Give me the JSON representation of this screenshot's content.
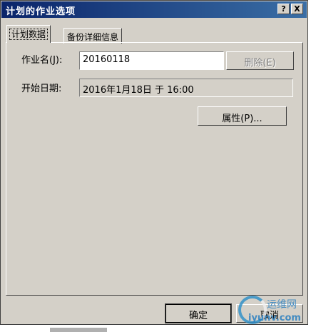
{
  "window": {
    "title": "计划的作业选项",
    "help_label": "?",
    "close_label": "X"
  },
  "tabs": [
    {
      "label": "计划数据",
      "active": true
    },
    {
      "label": "备份详细信息",
      "active": false
    }
  ],
  "form": {
    "name_label": "作业名(J):",
    "name_value": "20160118",
    "delete_label": "删除(E)",
    "start_label": "开始日期:",
    "start_value": "2016年1月18日 于 16:00",
    "properties_label": "属性(P)..."
  },
  "footer": {
    "ok_label": "确定",
    "cancel_label": "取消"
  },
  "watermark": {
    "brand": "运维网",
    "domain": "iyunv.com"
  },
  "colors": {
    "title_bar": "#0a246a",
    "dialog_face": "#d4d0c8",
    "watermark": "#2a7fc0"
  }
}
